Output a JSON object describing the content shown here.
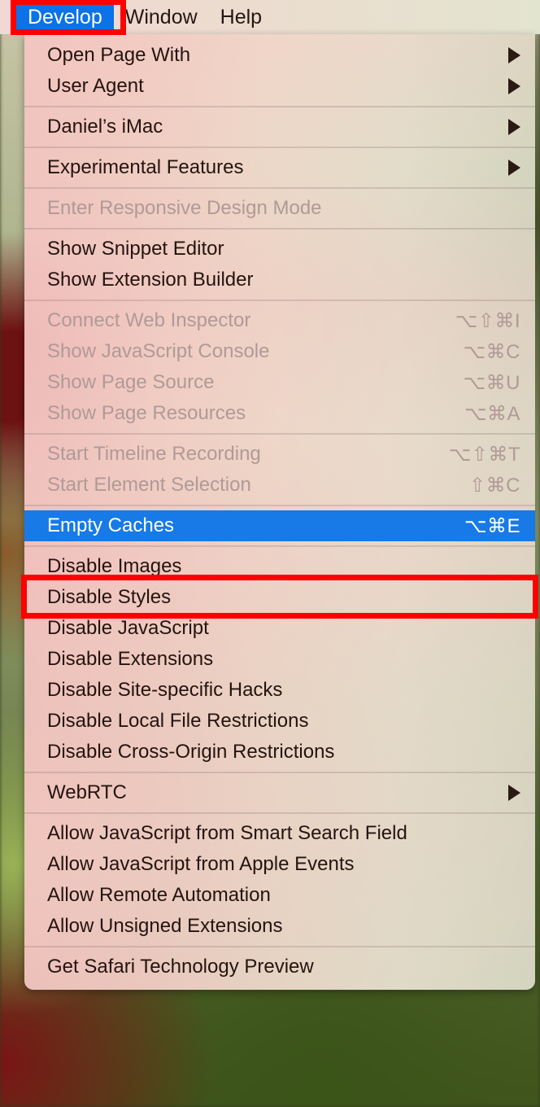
{
  "menubar": {
    "items": [
      {
        "label": "Develop",
        "active": true
      },
      {
        "label": "Window",
        "active": false
      },
      {
        "label": "Help",
        "active": false
      }
    ]
  },
  "menu": {
    "title": "Develop",
    "groups": [
      {
        "items": [
          {
            "label": "Open Page With",
            "shortcut": "",
            "submenu": true,
            "disabled": false,
            "highlighted": false
          },
          {
            "label": "User Agent",
            "shortcut": "",
            "submenu": true,
            "disabled": false,
            "highlighted": false
          }
        ]
      },
      {
        "items": [
          {
            "label": "Daniel’s iMac",
            "shortcut": "",
            "submenu": true,
            "disabled": false,
            "highlighted": false
          }
        ]
      },
      {
        "items": [
          {
            "label": "Experimental Features",
            "shortcut": "",
            "submenu": true,
            "disabled": false,
            "highlighted": false
          }
        ]
      },
      {
        "items": [
          {
            "label": "Enter Responsive Design Mode",
            "shortcut": "",
            "submenu": false,
            "disabled": true,
            "highlighted": false
          }
        ]
      },
      {
        "items": [
          {
            "label": "Show Snippet Editor",
            "shortcut": "",
            "submenu": false,
            "disabled": false,
            "highlighted": false
          },
          {
            "label": "Show Extension Builder",
            "shortcut": "",
            "submenu": false,
            "disabled": false,
            "highlighted": false
          }
        ]
      },
      {
        "items": [
          {
            "label": "Connect Web Inspector",
            "shortcut": "⌥⇧⌘I",
            "submenu": false,
            "disabled": true,
            "highlighted": false
          },
          {
            "label": "Show JavaScript Console",
            "shortcut": "⌥⌘C",
            "submenu": false,
            "disabled": true,
            "highlighted": false
          },
          {
            "label": "Show Page Source",
            "shortcut": "⌥⌘U",
            "submenu": false,
            "disabled": true,
            "highlighted": false
          },
          {
            "label": "Show Page Resources",
            "shortcut": "⌥⌘A",
            "submenu": false,
            "disabled": true,
            "highlighted": false
          }
        ]
      },
      {
        "items": [
          {
            "label": "Start Timeline Recording",
            "shortcut": "⌥⇧⌘T",
            "submenu": false,
            "disabled": true,
            "highlighted": false
          },
          {
            "label": "Start Element Selection",
            "shortcut": "⇧⌘C",
            "submenu": false,
            "disabled": true,
            "highlighted": false
          }
        ]
      },
      {
        "items": [
          {
            "label": "Empty Caches",
            "shortcut": "⌥⌘E",
            "submenu": false,
            "disabled": false,
            "highlighted": true
          }
        ]
      },
      {
        "items": [
          {
            "label": "Disable Images",
            "shortcut": "",
            "submenu": false,
            "disabled": false,
            "highlighted": false
          },
          {
            "label": "Disable Styles",
            "shortcut": "",
            "submenu": false,
            "disabled": false,
            "highlighted": false
          },
          {
            "label": "Disable JavaScript",
            "shortcut": "",
            "submenu": false,
            "disabled": false,
            "highlighted": false
          },
          {
            "label": "Disable Extensions",
            "shortcut": "",
            "submenu": false,
            "disabled": false,
            "highlighted": false
          },
          {
            "label": "Disable Site-specific Hacks",
            "shortcut": "",
            "submenu": false,
            "disabled": false,
            "highlighted": false
          },
          {
            "label": "Disable Local File Restrictions",
            "shortcut": "",
            "submenu": false,
            "disabled": false,
            "highlighted": false
          },
          {
            "label": "Disable Cross-Origin Restrictions",
            "shortcut": "",
            "submenu": false,
            "disabled": false,
            "highlighted": false
          }
        ]
      },
      {
        "items": [
          {
            "label": "WebRTC",
            "shortcut": "",
            "submenu": true,
            "disabled": false,
            "highlighted": false
          }
        ]
      },
      {
        "items": [
          {
            "label": "Allow JavaScript from Smart Search Field",
            "shortcut": "",
            "submenu": false,
            "disabled": false,
            "highlighted": false
          },
          {
            "label": "Allow JavaScript from Apple Events",
            "shortcut": "",
            "submenu": false,
            "disabled": false,
            "highlighted": false
          },
          {
            "label": "Allow Remote Automation",
            "shortcut": "",
            "submenu": false,
            "disabled": false,
            "highlighted": false
          },
          {
            "label": "Allow Unsigned Extensions",
            "shortcut": "",
            "submenu": false,
            "disabled": false,
            "highlighted": false
          }
        ]
      },
      {
        "items": [
          {
            "label": "Get Safari Technology Preview",
            "shortcut": "",
            "submenu": false,
            "disabled": false,
            "highlighted": false
          }
        ]
      }
    ]
  },
  "annotations": {
    "develop_box_color": "#ff0000",
    "empty_caches_box_color": "#ff0000",
    "highlight_color": "#177ae6",
    "menubar_highlight_color": "#0b72e7"
  }
}
